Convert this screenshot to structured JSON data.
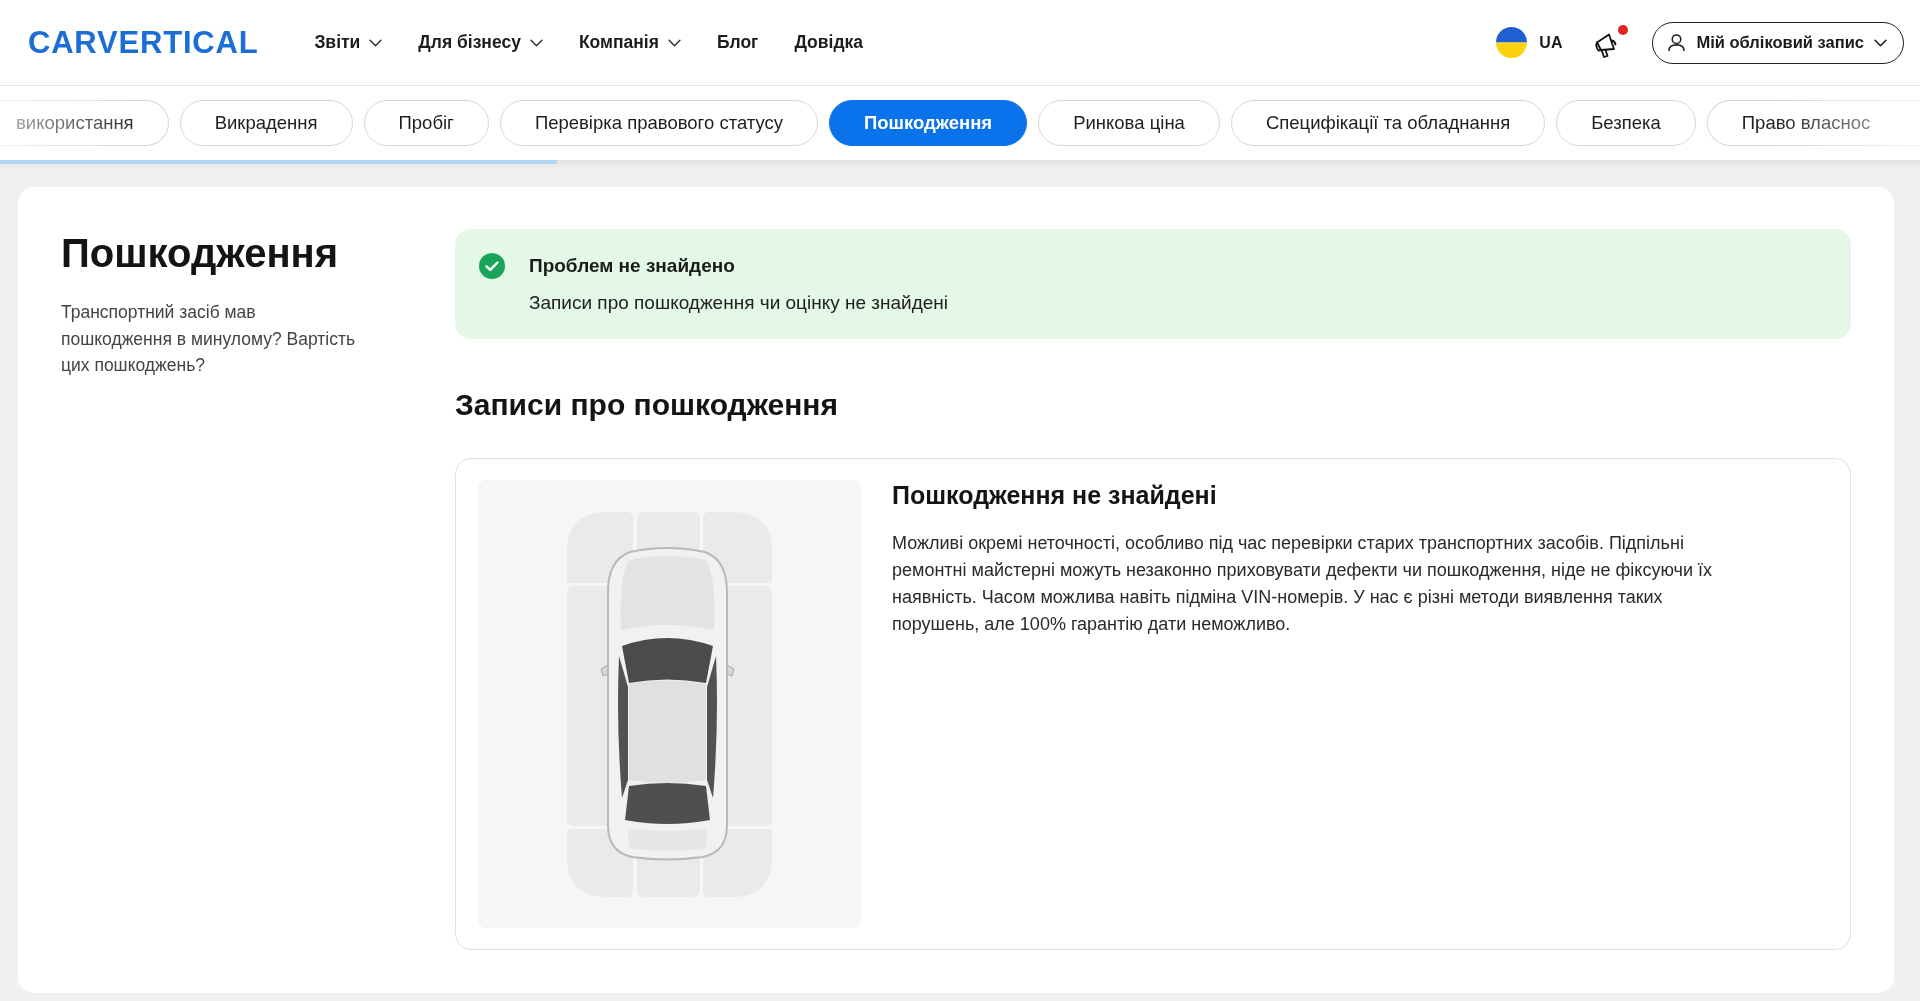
{
  "header": {
    "logo": "CARVERTICAL",
    "nav": [
      {
        "label": "Звіти",
        "kind": "dropdown"
      },
      {
        "label": "Для бізнесу",
        "kind": "dropdown"
      },
      {
        "label": "Компанія",
        "kind": "dropdown"
      },
      {
        "label": "Блог",
        "kind": "link"
      },
      {
        "label": "Довідка",
        "kind": "link"
      }
    ],
    "language": "UA",
    "notifications": {
      "unread": true
    },
    "account_button": "Мій обліковий запис"
  },
  "section_tabs": {
    "items": [
      {
        "label": "використання",
        "selected": false
      },
      {
        "label": "Викрадення",
        "selected": false
      },
      {
        "label": "Пробіг",
        "selected": false
      },
      {
        "label": "Перевірка правового статусу",
        "selected": false
      },
      {
        "label": "Пошкодження",
        "selected": true
      },
      {
        "label": "Ринкова ціна",
        "selected": false
      },
      {
        "label": "Специфікації та обладнання",
        "selected": false
      },
      {
        "label": "Безпека",
        "selected": false
      },
      {
        "label": "Право власнос",
        "selected": false
      }
    ],
    "progress": {
      "level": 0.29
    }
  },
  "section": {
    "title": "Пошкодження",
    "description": "Транспортний засіб мав пошкодження в минулому? Вартість цих пошкоджень?",
    "alert": {
      "kind": "success",
      "title": "Проблем не знайдено",
      "text": "Записи про пошкодження чи оцінку не знайдені"
    },
    "records_heading": "Записи про пошкодження",
    "record_card": {
      "title": "Пошкодження не знайдені",
      "text": "Можливі окремі неточності, особливо під час перевірки старих транспортних засобів. Підпільні ремонтні майстерні можуть незаконно приховувати дефекти чи пошкодження, ніде не фіксуючи їх наявність. Часом можлива навіть підміна VIN-номерів. У нас є різні методи виявлення таких порушень, але 100% гарантію дати неможливо."
    }
  }
}
